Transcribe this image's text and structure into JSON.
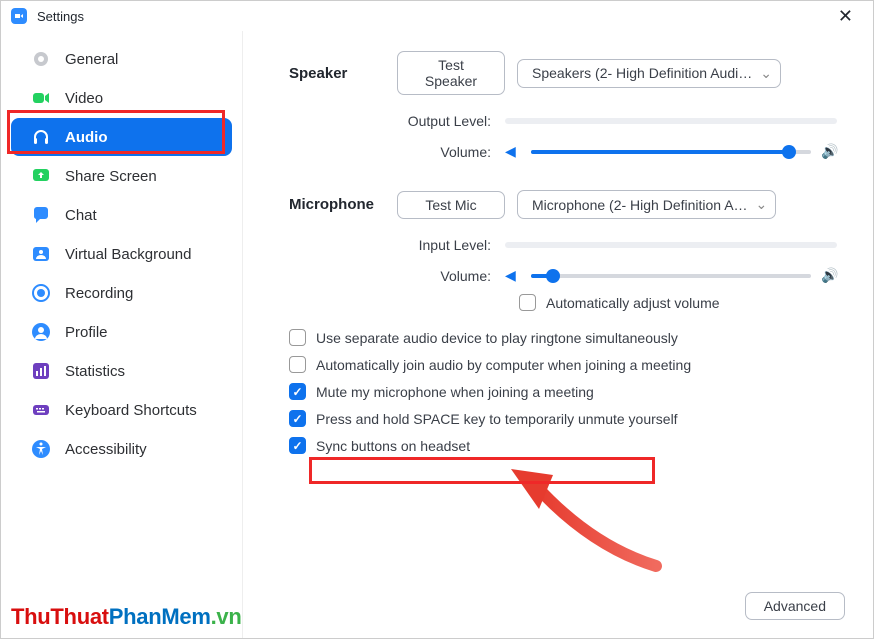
{
  "window": {
    "title": "Settings"
  },
  "sidebar": {
    "items": [
      {
        "label": "General",
        "icon": "gear"
      },
      {
        "label": "Video",
        "icon": "video"
      },
      {
        "label": "Audio",
        "icon": "headphones",
        "selected": true
      },
      {
        "label": "Share Screen",
        "icon": "share"
      },
      {
        "label": "Chat",
        "icon": "chat"
      },
      {
        "label": "Virtual Background",
        "icon": "vbg"
      },
      {
        "label": "Recording",
        "icon": "record"
      },
      {
        "label": "Profile",
        "icon": "profile"
      },
      {
        "label": "Statistics",
        "icon": "stats"
      },
      {
        "label": "Keyboard Shortcuts",
        "icon": "keyboard"
      },
      {
        "label": "Accessibility",
        "icon": "access"
      }
    ]
  },
  "speaker": {
    "label": "Speaker",
    "test_btn": "Test Speaker",
    "device": "Speakers (2- High Definition Audi…",
    "output_level_label": "Output Level:",
    "volume_label": "Volume:",
    "volume_pct": 92
  },
  "mic": {
    "label": "Microphone",
    "test_btn": "Test Mic",
    "device": "Microphone (2- High Definition A…",
    "input_level_label": "Input Level:",
    "volume_label": "Volume:",
    "volume_pct": 8,
    "auto_adjust": {
      "label": "Automatically adjust volume",
      "checked": false
    }
  },
  "options": {
    "separate_device": {
      "label": "Use separate audio device to play ringtone simultaneously",
      "checked": false
    },
    "auto_join": {
      "label": "Automatically join audio by computer when joining a meeting",
      "checked": false
    },
    "mute_on_join": {
      "label": "Mute my microphone when joining a meeting",
      "checked": true
    },
    "space_unmute": {
      "label": "Press and hold SPACE key to temporarily unmute yourself",
      "checked": true
    },
    "sync_headset": {
      "label": "Sync buttons on headset",
      "checked": true
    }
  },
  "advanced_btn": "Advanced",
  "watermark": {
    "a": "ThuThuat",
    "b": "PhanMem",
    "c": ".vn"
  }
}
